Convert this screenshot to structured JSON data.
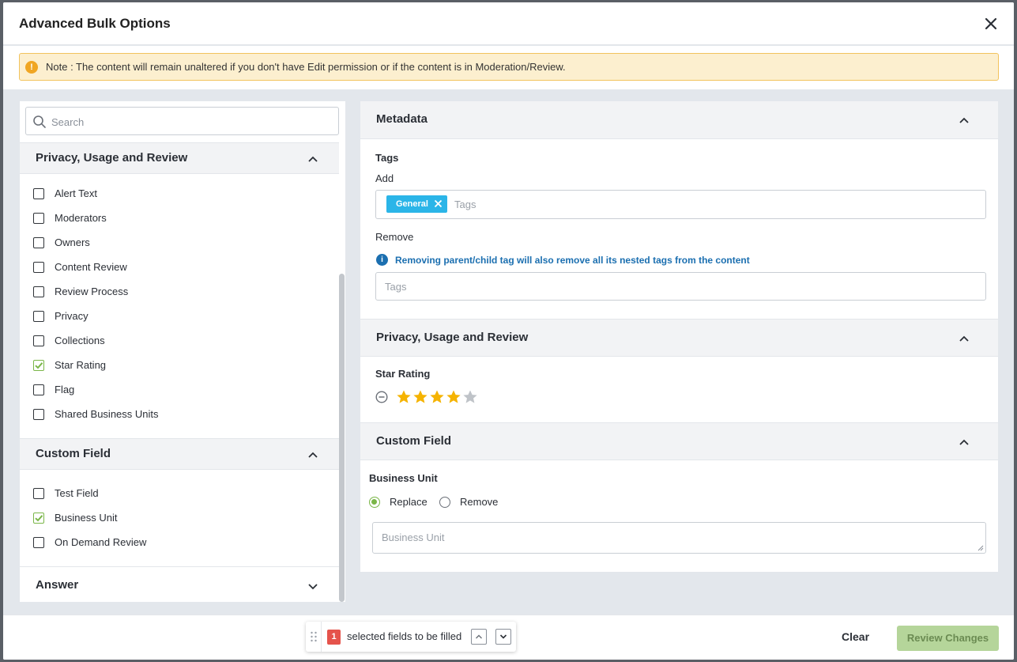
{
  "modal": {
    "title": "Advanced Bulk Options"
  },
  "note": {
    "text": "Note : The content will remain unaltered if you don't have Edit permission or if the content is in Moderation/Review."
  },
  "left_panel": {
    "search_placeholder": "Search",
    "sections": [
      {
        "title": "Privacy, Usage and Review",
        "expanded": true,
        "items": [
          {
            "label": "Alert Text",
            "checked": false
          },
          {
            "label": "Moderators",
            "checked": false
          },
          {
            "label": "Owners",
            "checked": false
          },
          {
            "label": "Content Review",
            "checked": false
          },
          {
            "label": "Review Process",
            "checked": false
          },
          {
            "label": "Privacy",
            "checked": false
          },
          {
            "label": "Collections",
            "checked": false
          },
          {
            "label": "Star Rating",
            "checked": true
          },
          {
            "label": "Flag",
            "checked": false
          },
          {
            "label": "Shared Business Units",
            "checked": false
          }
        ]
      },
      {
        "title": "Custom Field",
        "expanded": true,
        "items": [
          {
            "label": "Test Field",
            "checked": false
          },
          {
            "label": "Business Unit",
            "checked": true
          },
          {
            "label": "On Demand Review",
            "checked": false
          }
        ]
      },
      {
        "title": "Answer",
        "expanded": false,
        "items": []
      }
    ]
  },
  "right_panel": {
    "metadata": {
      "title": "Metadata",
      "tags_label": "Tags",
      "add_label": "Add",
      "add_chips": [
        "General"
      ],
      "add_placeholder": "Tags",
      "remove_label": "Remove",
      "remove_info": "Removing parent/child tag will also remove all its nested tags from the content",
      "remove_placeholder": "Tags"
    },
    "privacy": {
      "title": "Privacy, Usage and Review",
      "star_label": "Star Rating",
      "star_rating": 4,
      "star_max": 5
    },
    "custom_field": {
      "title": "Custom Field",
      "field_label": "Business Unit",
      "options": [
        "Replace",
        "Remove"
      ],
      "selected": "Replace",
      "placeholder": "Business Unit"
    }
  },
  "footer": {
    "selected_count": "1",
    "selected_text": "selected fields to be filled",
    "clear_label": "Clear",
    "review_label": "Review Changes"
  },
  "colors": {
    "accent_green": "#7ab648",
    "chip_blue": "#2bb5e8",
    "info_blue": "#1b6fb0",
    "star_gold": "#f5b301",
    "count_red": "#e5534b",
    "note_bg": "#fcefcf"
  }
}
